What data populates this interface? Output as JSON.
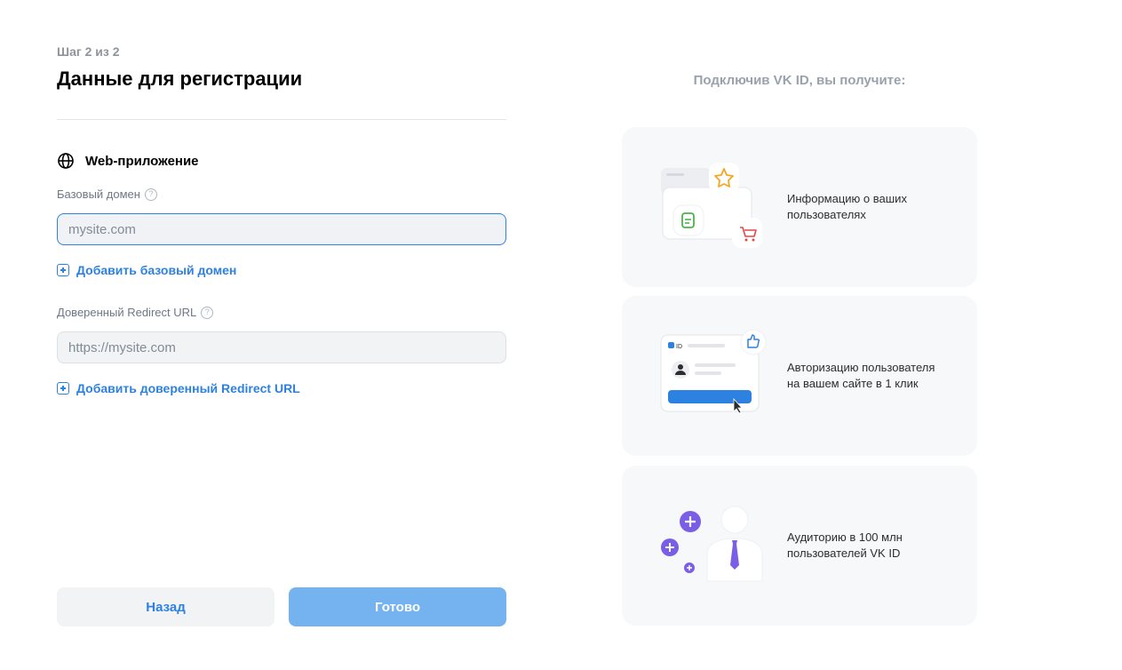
{
  "header": {
    "step": "Шаг 2 из 2",
    "title": "Данные для регистрации"
  },
  "platform": {
    "label": "Web-приложение",
    "icon": "globe-icon"
  },
  "base_domain": {
    "label": "Базовый домен",
    "value": "",
    "placeholder": "mysite.com",
    "add_label": "Добавить базовый домен"
  },
  "redirect": {
    "label": "Доверенный Redirect URL",
    "value": "",
    "placeholder": "https://mysite.com",
    "add_label": "Добавить доверенный Redirect URL"
  },
  "help_glyph": "?",
  "buttons": {
    "back": "Назад",
    "done": "Готово"
  },
  "benefits": {
    "heading": "Подключив VK ID, вы получите:",
    "items": [
      {
        "text": "Информацию о ваших\nпользователях",
        "icon": "user-data-illustration"
      },
      {
        "text": "Авторизацию пользователя\nна вашем сайте в 1 клик",
        "icon": "login-illustration"
      },
      {
        "text": "Аудиторию в 100 млн\nпользователей VK ID",
        "icon": "audience-illustration"
      }
    ],
    "id_badge": "ID"
  },
  "colors": {
    "accent": "#2d81e0",
    "primary_disabled": "#74b3f0",
    "purple": "#7b5ee6",
    "card_bg": "#f7f8fa"
  }
}
